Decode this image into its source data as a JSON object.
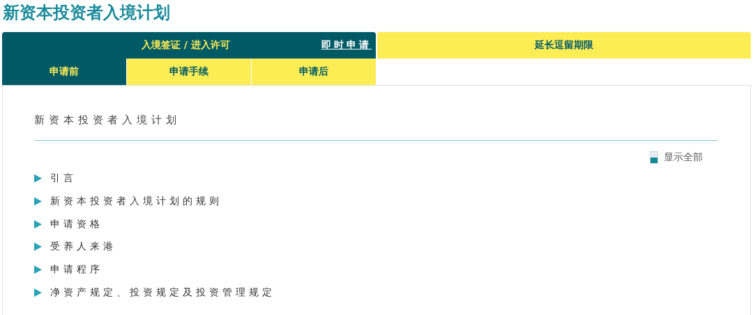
{
  "page_title": "新资本投资者入境计划",
  "top_tabs": [
    {
      "label": "入境签证 / 进入许可",
      "selected": true
    },
    {
      "label": "延长逗留期限",
      "selected": false
    }
  ],
  "apply_link": "即时申请",
  "sub_tabs": [
    {
      "label": "申请前",
      "selected": true
    },
    {
      "label": "申请手续",
      "selected": false
    },
    {
      "label": "申请后",
      "selected": false
    }
  ],
  "section_heading": "新资本投资者入境计划",
  "show_all": {
    "label": "显示全部",
    "checked": false
  },
  "items": [
    {
      "label": "引言",
      "expanded": false
    },
    {
      "label": "新资本投资者入境计划的规则",
      "expanded": false
    },
    {
      "label": "申请资格",
      "expanded": false
    },
    {
      "label": "受养人来港",
      "expanded": false
    },
    {
      "label": "申请程序",
      "expanded": false
    },
    {
      "label": "净资产规定、投资规定及投资管理规定",
      "expanded": false
    }
  ]
}
